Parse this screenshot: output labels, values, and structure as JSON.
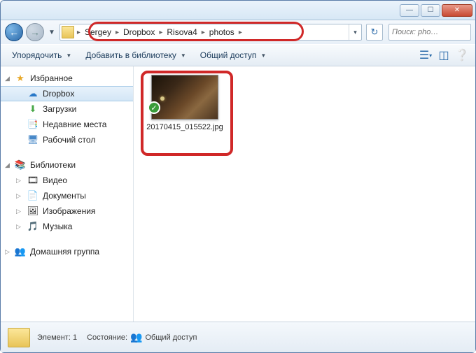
{
  "breadcrumb": [
    "Sergey",
    "Dropbox",
    "Risova4",
    "photos"
  ],
  "search": {
    "placeholder": "Поиск: pho…"
  },
  "toolbar": {
    "organize": "Упорядочить",
    "add_library": "Добавить в библиотеку",
    "share": "Общий доступ"
  },
  "sidebar": {
    "favorites": {
      "label": "Избранное",
      "items": [
        {
          "label": "Dropbox",
          "icon": "☁"
        },
        {
          "label": "Загрузки",
          "icon": "⬇"
        },
        {
          "label": "Недавние места",
          "icon": "📑"
        },
        {
          "label": "Рабочий стол",
          "icon": "🖥"
        }
      ]
    },
    "libraries": {
      "label": "Библиотеки",
      "items": [
        {
          "label": "Видео",
          "icon": "🎞"
        },
        {
          "label": "Документы",
          "icon": "📄"
        },
        {
          "label": "Изображения",
          "icon": "🖼"
        },
        {
          "label": "Музыка",
          "icon": "🎵"
        }
      ]
    },
    "homegroup": {
      "label": "Домашняя группа",
      "icon": "👥"
    }
  },
  "file": {
    "name": "20170415_015522.jpg"
  },
  "statusbar": {
    "count_label": "Элемент: 1",
    "state_label": "Состояние:",
    "share_label": "Общий доступ"
  }
}
